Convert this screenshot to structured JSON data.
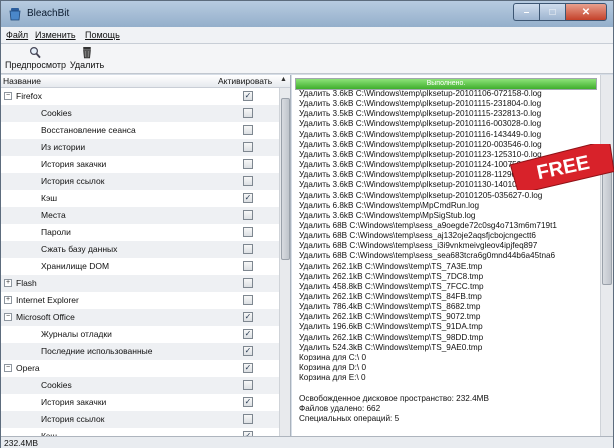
{
  "window": {
    "title": "BleachBit",
    "minimize": "–",
    "maximize": "□",
    "close": "✕"
  },
  "menu": [
    {
      "label": "Файл"
    },
    {
      "label": "Изменить"
    },
    {
      "label": "Помощь"
    }
  ],
  "toolbar": {
    "preview_label": "Предпросмотр",
    "preview_icon": "magnifier-icon",
    "delete_label": "Удалить",
    "delete_icon": "trash-can-icon"
  },
  "tree_header": {
    "name": "Название",
    "enable": "Активировать"
  },
  "tree": [
    {
      "label": "Firefox",
      "level": 0,
      "expanded": true,
      "checked": true
    },
    {
      "label": "Cookies",
      "level": 1,
      "checked": false
    },
    {
      "label": "Восстановление сеанса",
      "level": 1,
      "checked": false
    },
    {
      "label": "Из истории",
      "level": 1,
      "checked": false
    },
    {
      "label": "История закачки",
      "level": 1,
      "checked": false
    },
    {
      "label": "История ссылок",
      "level": 1,
      "checked": false
    },
    {
      "label": "Кэш",
      "level": 1,
      "checked": true
    },
    {
      "label": "Места",
      "level": 1,
      "checked": false
    },
    {
      "label": "Пароли",
      "level": 1,
      "checked": false
    },
    {
      "label": "Сжать базу данных",
      "level": 1,
      "checked": false
    },
    {
      "label": "Хранилище DOM",
      "level": 1,
      "checked": false
    },
    {
      "label": "Flash",
      "level": 0,
      "expanded": false,
      "checked": false
    },
    {
      "label": "Internet Explorer",
      "level": 0,
      "expanded": false,
      "checked": false
    },
    {
      "label": "Microsoft Office",
      "level": 0,
      "expanded": true,
      "checked": true
    },
    {
      "label": "Журналы отладки",
      "level": 1,
      "checked": true
    },
    {
      "label": "Последние использованные",
      "level": 1,
      "checked": true
    },
    {
      "label": "Opera",
      "level": 0,
      "expanded": true,
      "checked": true
    },
    {
      "label": "Cookies",
      "level": 1,
      "checked": false
    },
    {
      "label": "История закачки",
      "level": 1,
      "checked": true
    },
    {
      "label": "История ссылок",
      "level": 1,
      "checked": false
    },
    {
      "label": "Кэш",
      "level": 1,
      "checked": true
    },
    {
      "label": "Текущая сессия",
      "level": 1,
      "checked": false
    }
  ],
  "progress": {
    "label": "Выполнено.",
    "fraction": 1.0
  },
  "log": [
    "Удалить 3.6kB C:\\Windows\\temp\\plksetup-20101106-072158-0.log",
    "Удалить 3.6kB C:\\Windows\\temp\\plksetup-20101115-231804-0.log",
    "Удалить 3.5kB C:\\Windows\\temp\\plksetup-20101115-232813-0.log",
    "Удалить 3.6kB C:\\Windows\\temp\\plksetup-20101116-003028-0.log",
    "Удалить 3.6kB C:\\Windows\\temp\\plksetup-20101116-143449-0.log",
    "Удалить 3.6kB C:\\Windows\\temp\\plksetup-20101120-003546-0.log",
    "Удалить 3.6kB C:\\Windows\\temp\\plksetup-20101123-125310-0.log",
    "Удалить 3.6kB C:\\Windows\\temp\\plksetup-20101124-100759-0.log",
    "Удалить 3.6kB C:\\Windows\\temp\\plksetup-20101128-112904-0.log",
    "Удалить 3.6kB C:\\Windows\\temp\\plksetup-20101130-140105-0.log",
    "Удалить 3.6kB C:\\Windows\\temp\\plksetup-20101205-035627-0.log",
    "Удалить 6.8kB C:\\Windows\\temp\\MpCmdRun.log",
    "Удалить 3.6kB C:\\Windows\\temp\\MpSigStub.log",
    "Удалить 68B C:\\Windows\\temp\\sess_a9oegde72c0sg4o713m6m719t1",
    "Удалить 68B C:\\Windows\\temp\\sess_aj132oje2aqsfjcbojcngectt6",
    "Удалить 68B C:\\Windows\\temp\\sess_i3i9vnkmeivgleov4ipjfeq897",
    "Удалить 68B C:\\Windows\\temp\\sess_sea683tcra6g0mnd44b6a45tna6",
    "Удалить 262.1kB C:\\Windows\\temp\\TS_7A3E.tmp",
    "Удалить 262.1kB C:\\Windows\\temp\\TS_7DC8.tmp",
    "Удалить 458.8kB C:\\Windows\\temp\\TS_7FCC.tmp",
    "Удалить 262.1kB C:\\Windows\\temp\\TS_84FB.tmp",
    "Удалить 786.4kB C:\\Windows\\temp\\TS_8682.tmp",
    "Удалить 262.1kB C:\\Windows\\temp\\TS_9072.tmp",
    "Удалить 196.6kB C:\\Windows\\temp\\TS_91DA.tmp",
    "Удалить 262.1kB C:\\Windows\\temp\\TS_98DD.tmp",
    "Удалить 524.3kB C:\\Windows\\temp\\TS_9AE0.tmp",
    "Корзина для C:\\ 0",
    "Корзина для D:\\ 0",
    "Корзина для E:\\ 0",
    "",
    "Освобожденное дисковое пространство: 232.4MB",
    "Файлов удалено: 662",
    "Специальных операций: 5"
  ],
  "status": {
    "text": "232.4MB"
  },
  "badge": {
    "text": "FREE",
    "color": "#d8222a"
  },
  "colors": {
    "progress": "#4fbf38",
    "title_bar": "#a7bfd8",
    "badge": "#d8222a"
  }
}
